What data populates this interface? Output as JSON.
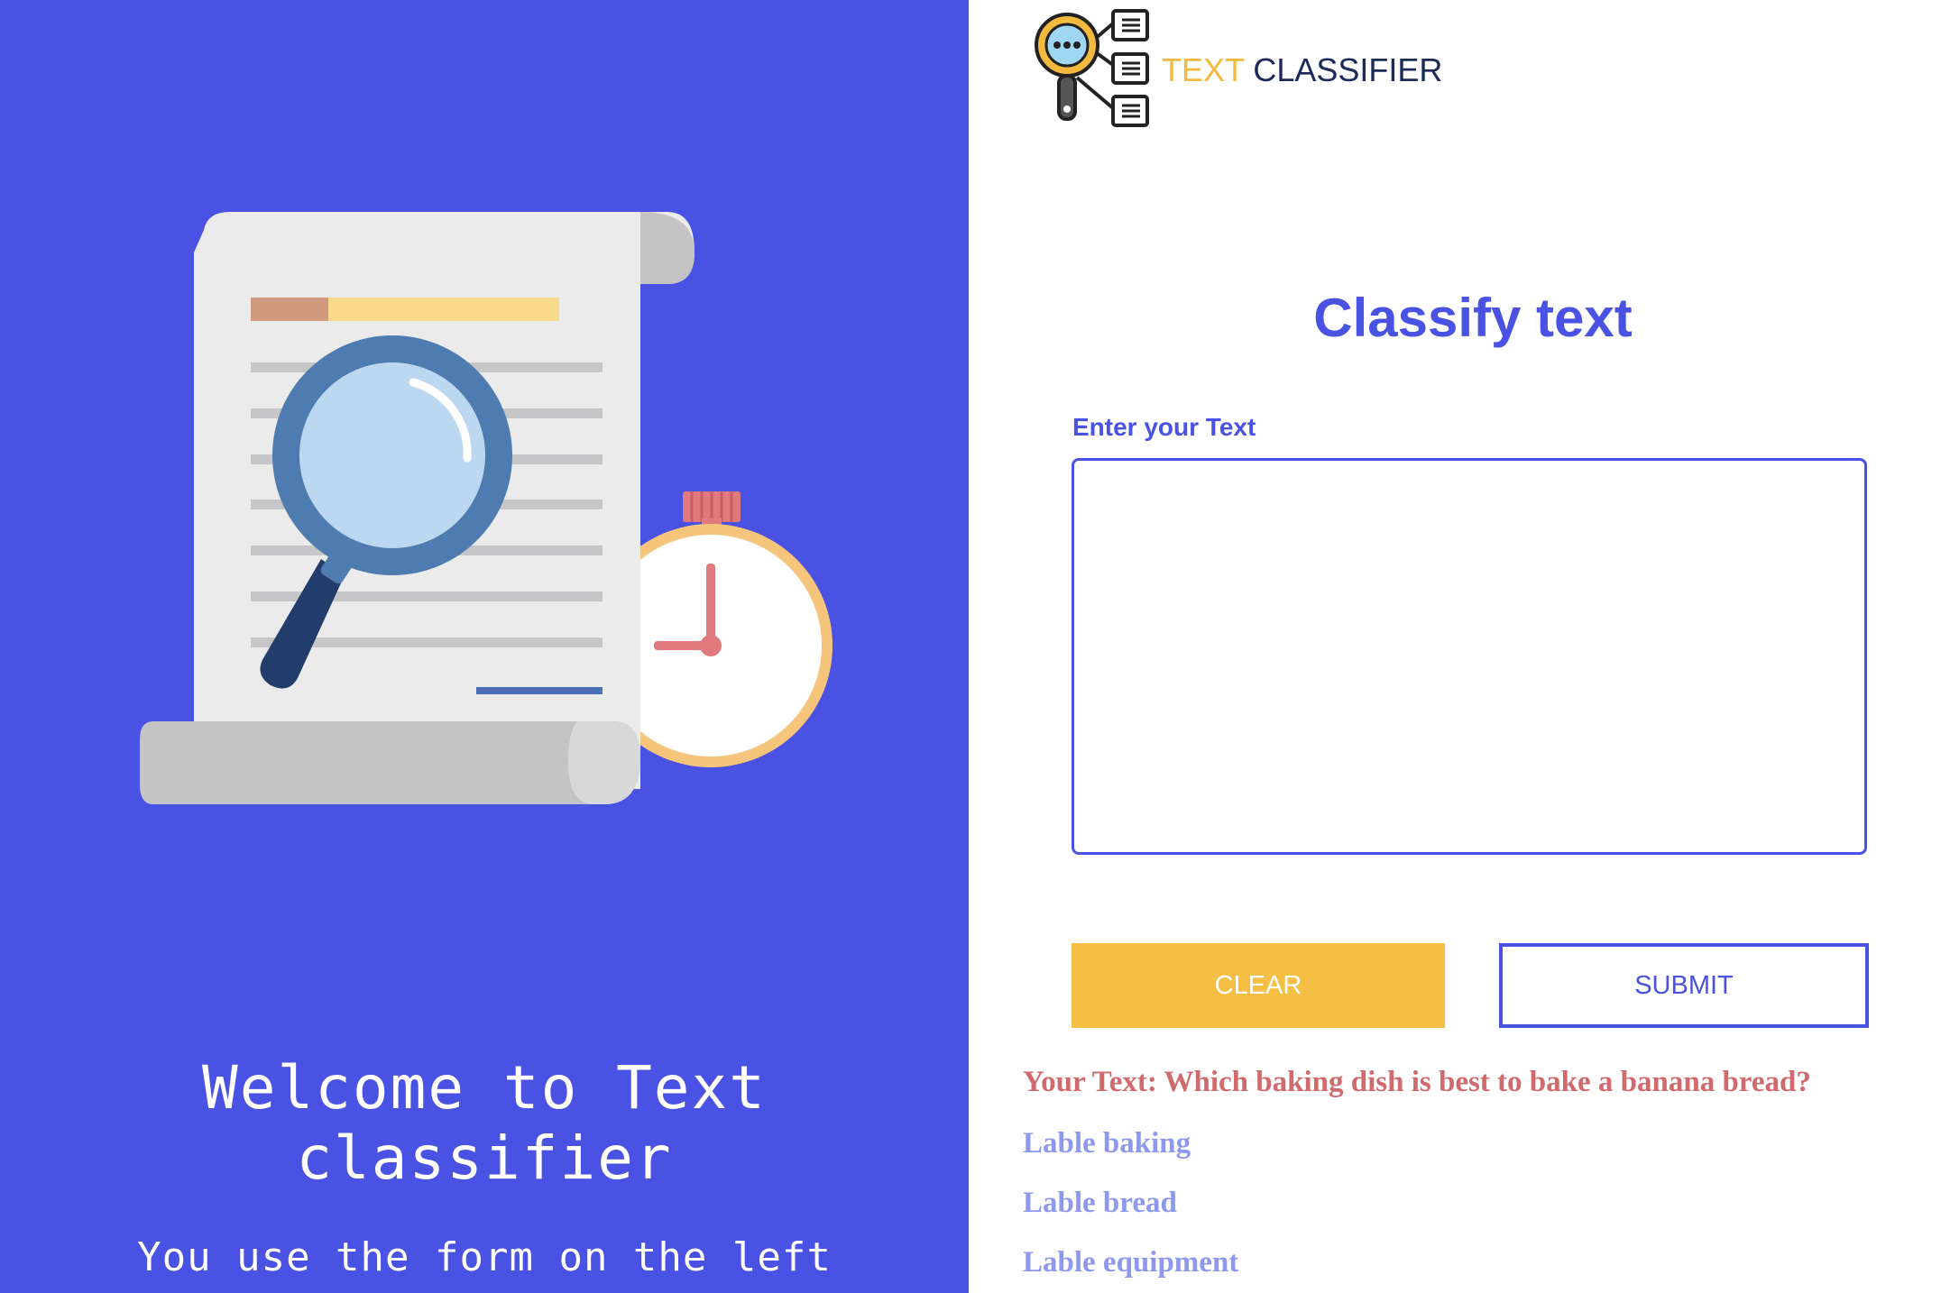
{
  "welcome": {
    "title_line1": "Welcome to Text",
    "title_line2": "classifier",
    "subtitle": "You use the form on the left"
  },
  "brand": {
    "name_part1": "TEXT",
    "name_part2": "CLASSIFIER",
    "logo_icon": "magnifier-document-icon"
  },
  "form": {
    "title": "Classify text",
    "input_label": "Enter your Text",
    "input_value": "",
    "clear_label": "CLEAR",
    "submit_label": "SUBMIT"
  },
  "result": {
    "text": "Your Text: Which baking dish is best to bake a banana bread?",
    "labels": [
      "Lable baking",
      "Lable bread",
      "Lable equipment"
    ]
  },
  "colors": {
    "primary": "#4a52e3",
    "accent": "#f5bf44",
    "result_text": "#d16a6d",
    "label_text": "#8e98ee"
  }
}
